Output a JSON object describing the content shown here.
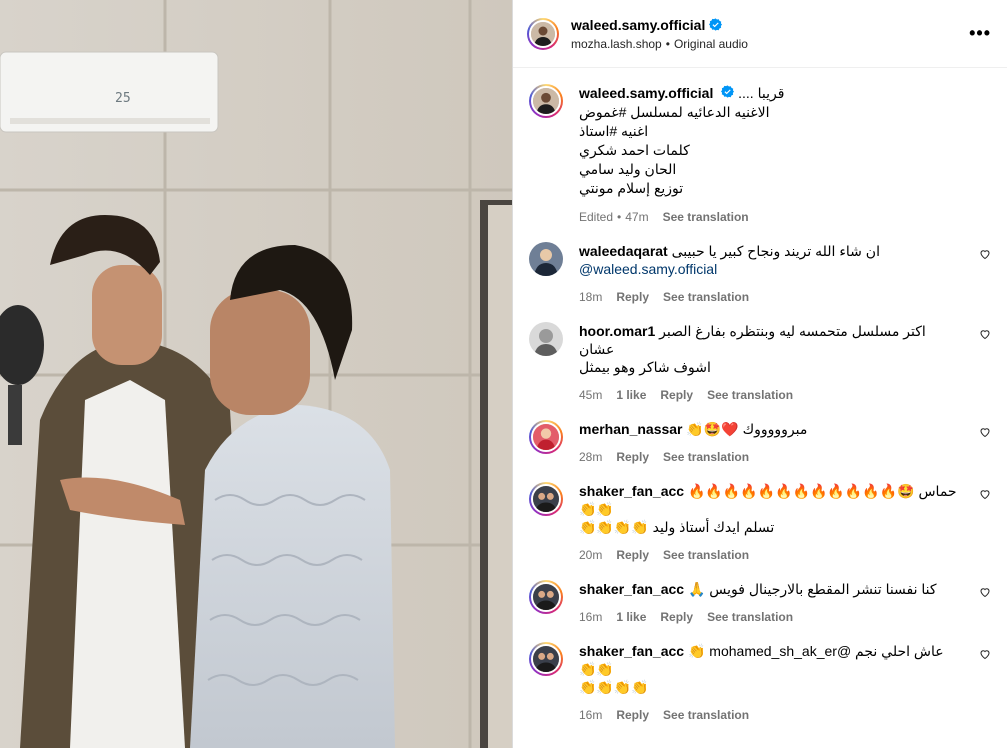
{
  "post": {
    "author": "waleed.samy.official",
    "location": "mozha.lash.shop",
    "separator": "•",
    "audio": "Original audio",
    "more_icon": "more-horizontal-icon",
    "ac_display": "25"
  },
  "caption": {
    "user": "waleed.samy.official",
    "lines": [
      "قريبا ....",
      "الاغنيه الدعائيه لمسلسل #غموض",
      "اغنيه #استاذ",
      "كلمات احمد شكري",
      "الحان وليد سامي",
      "توزيع إسلام مونتي"
    ],
    "edited": "Edited",
    "time": "47m",
    "translate": "See translation"
  },
  "comments": [
    {
      "user": "waleedaqarat",
      "text": "ان شاء الله تريند ونجاح كبير يا حبيبى",
      "text2": "@waleed.samy.official",
      "time": "18m",
      "likes": "",
      "reply": "Reply",
      "translate": "See translation"
    },
    {
      "user": "hoor.omar1",
      "text": "اكتر مسلسل متحمسه ليه وبنتظره بفارغ الصبر عشان",
      "text2": "اشوف شاكر وهو بيمثل",
      "time": "45m",
      "likes": "1 like",
      "reply": "Reply",
      "translate": "See translation"
    },
    {
      "user": "merhan_nassar",
      "text": "مبروووووك ❤️🤩👏",
      "text2": "",
      "time": "28m",
      "likes": "",
      "reply": "Reply",
      "translate": "See translation"
    },
    {
      "user": "shaker_fan_acc",
      "text": "حماس 🤩🔥🔥🔥🔥🔥🔥🔥🔥🔥🔥🔥🔥👏👏",
      "text2": "تسلم ايدك أستاذ وليد 👏👏👏👏",
      "time": "20m",
      "likes": "",
      "reply": "Reply",
      "translate": "See translation"
    },
    {
      "user": "shaker_fan_acc",
      "text": "كنا نفسنا تنشر المقطع بالارجينال فويس 🙏",
      "text2": "",
      "time": "16m",
      "likes": "1 like",
      "reply": "Reply",
      "translate": "See translation"
    },
    {
      "user": "shaker_fan_acc",
      "text": "عاش احلي نجم @mohamed_sh_ak_er 👏👏👏",
      "text2": "👏👏👏👏",
      "time": "16m",
      "likes": "",
      "reply": "Reply",
      "translate": "See translation"
    }
  ],
  "colors": {
    "verified": "#0095f6",
    "link": "#00376b",
    "muted": "#737373",
    "heart_red": "#ed4956"
  }
}
